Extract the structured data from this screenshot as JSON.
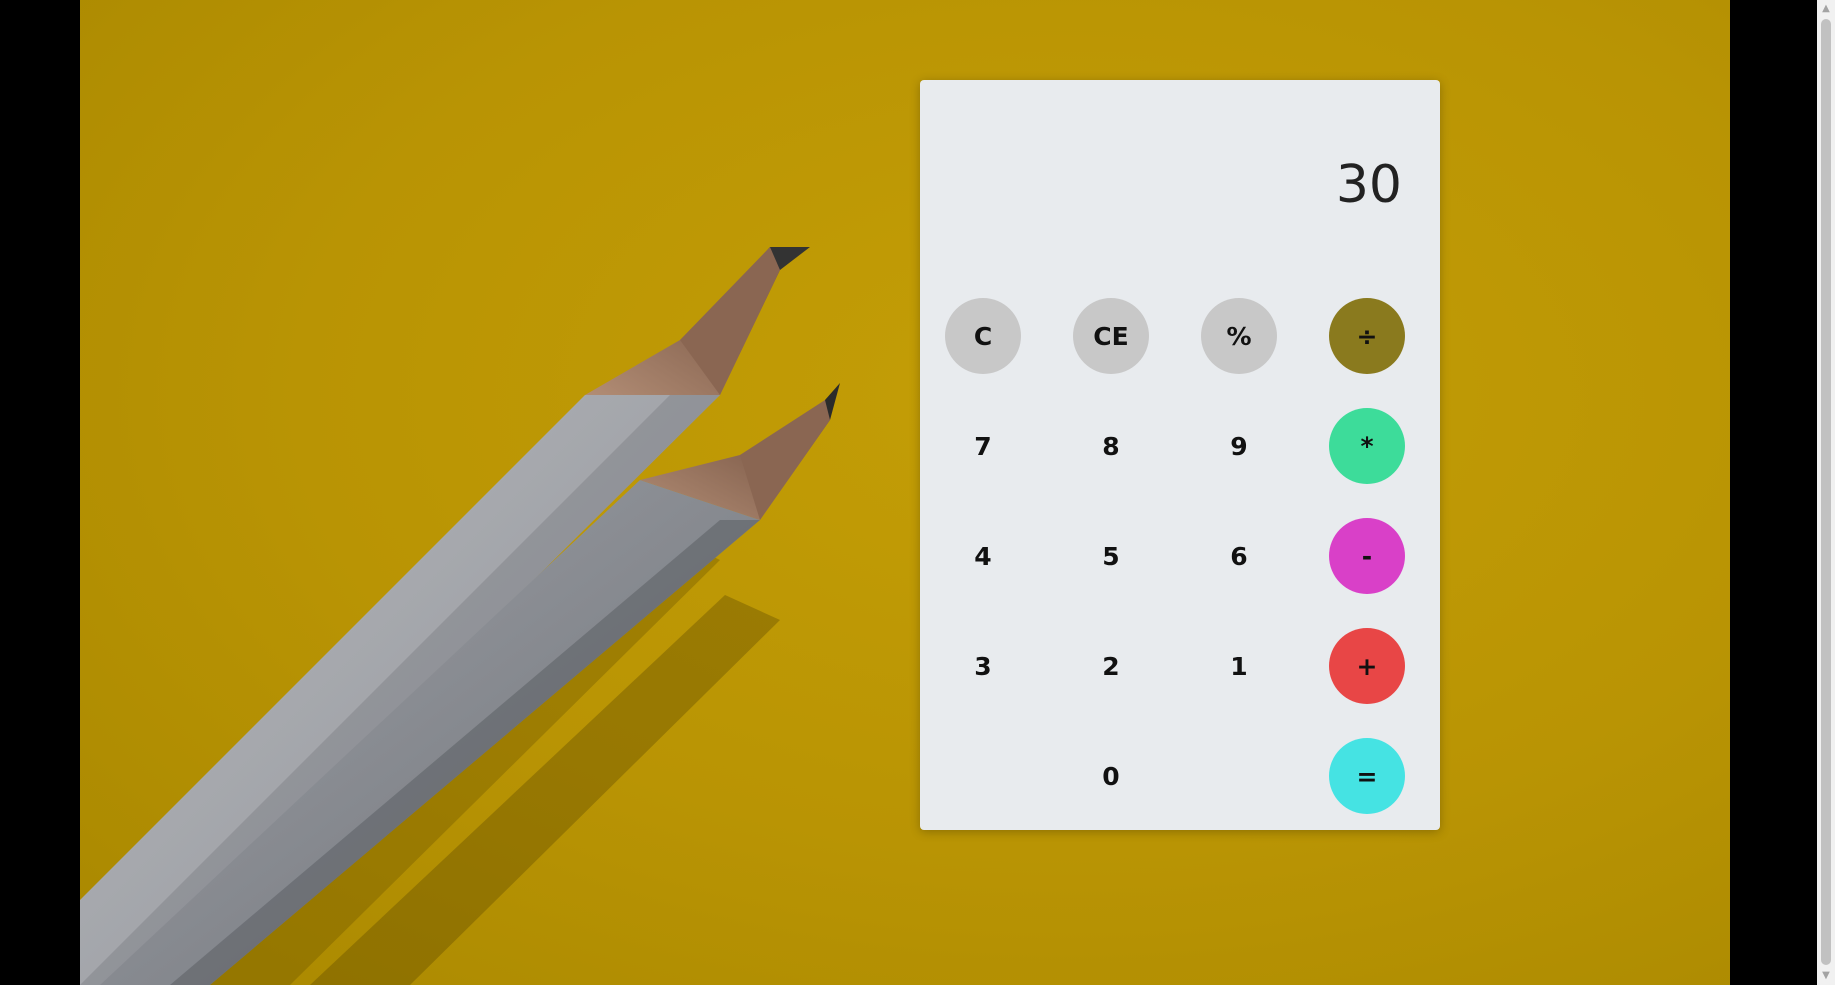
{
  "calculator": {
    "display_value": "30",
    "keys": {
      "clear": "C",
      "clear_entry": "CE",
      "percent": "%",
      "divide": "÷",
      "seven": "7",
      "eight": "8",
      "nine": "9",
      "multiply": "*",
      "four": "4",
      "five": "5",
      "six": "6",
      "subtract": "-",
      "three": "3",
      "two": "2",
      "one": "1",
      "add": "+",
      "zero": "0",
      "equals": "="
    },
    "colors": {
      "divide": "#8a7a1e",
      "multiply": "#3ddc9a",
      "subtract": "#d940c8",
      "add": "#e84646",
      "equals": "#45e3e3",
      "function_keys": "#c8c8c8",
      "panel": "#e8ebee"
    }
  },
  "background": {
    "description_icon": "pencils-photo",
    "color": "#b99404"
  }
}
